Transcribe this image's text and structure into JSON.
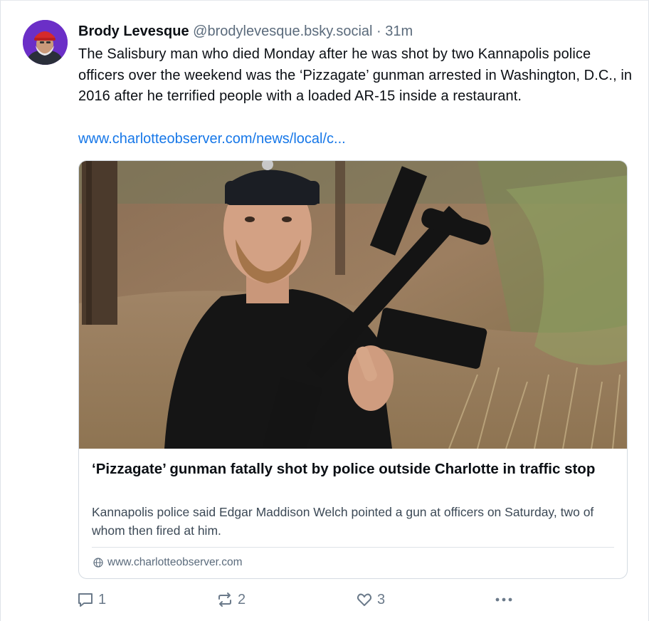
{
  "post": {
    "author": "Brody Levesque",
    "handle": "@brodylevesque.bsky.social",
    "separator": "·",
    "time": "31m",
    "text": "The Salisbury man who died Monday after he was shot by two Kannapolis police officers over the weekend was the ‘Pizzagate’ gunman arrested in Washington, D.C., in 2016 after he terrified people with a loaded AR-15 inside a restaurant.",
    "link": "www.charlotteobserver.com/news/local/c..."
  },
  "card": {
    "title": "‘Pizzagate’ gunman fatally shot by police outside Charlotte in traffic stop",
    "description": "Kannapolis police said Edgar Maddison Welch pointed a gun at officers on Saturday, two of whom then fired at him.",
    "domain": "www.charlotteobserver.com",
    "domain_icon": "globe-icon"
  },
  "actions": {
    "replies": "1",
    "reposts": "2",
    "likes": "3",
    "reply_icon": "speech-bubble-icon",
    "repost_icon": "repost-arrows-icon",
    "like_icon": "heart-icon",
    "more_icon": "ellipsis-icon"
  },
  "colors": {
    "text": "#0b0f14",
    "muted": "#5b6b7c",
    "link": "#1677e8",
    "border": "#d4dbe2",
    "avatar_bg": "#6b2fc7"
  }
}
